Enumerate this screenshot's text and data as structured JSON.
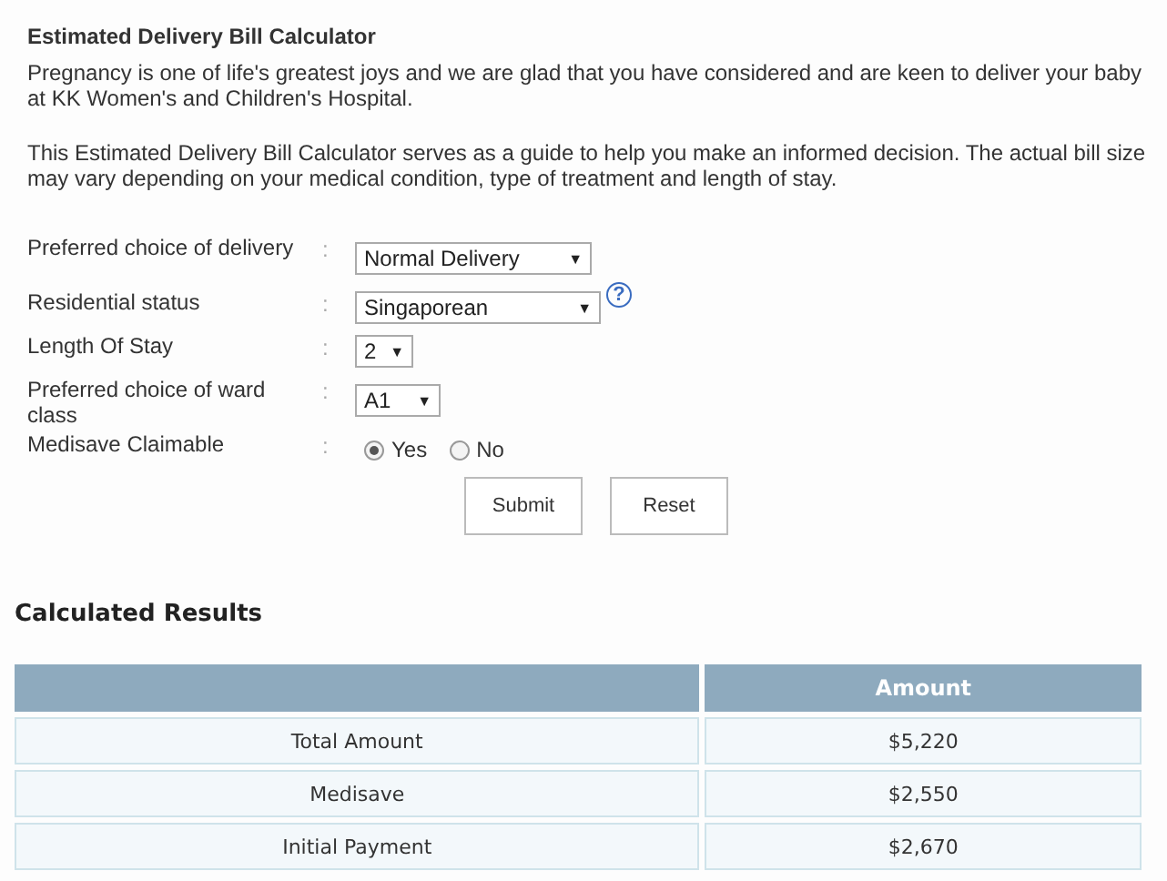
{
  "calculator": {
    "title": "Estimated Delivery Bill Calculator",
    "paragraphs": [
      "Pregnancy is one of life's greatest joys and we are glad that you have considered and are keen to deliver your baby at KK Women's and Children's Hospital.",
      "This Estimated Delivery Bill Calculator serves as a guide to help you make an informed decision. The actual bill size may vary depending on your medical condition, type of treatment and length of stay."
    ],
    "fields": [
      {
        "kind": "select",
        "label": "Preferred choice of delivery",
        "separator": ":",
        "value": "Normal Delivery",
        "arrow": "▼"
      },
      {
        "kind": "select",
        "label": "Residential status",
        "separator": ":",
        "value": "Singaporean",
        "arrow": "▼",
        "help": "?"
      },
      {
        "kind": "select",
        "label": "Length Of Stay",
        "separator": ":",
        "value": "2",
        "arrow": "▼"
      },
      {
        "kind": "select",
        "label": "Preferred choice of ward class",
        "separator": ":",
        "value": "A1",
        "arrow": "▼"
      },
      {
        "kind": "radio",
        "label": "Medisave Claimable",
        "separator": ":",
        "options": [
          {
            "label": "Yes",
            "selected": true
          },
          {
            "label": "No",
            "selected": false
          }
        ]
      }
    ],
    "buttons": [
      "Submit",
      "Reset"
    ]
  },
  "results": {
    "title": "Calculated Results",
    "table": {
      "columns": [
        "Amount"
      ],
      "rows": [
        {
          "item": "Total Amount",
          "amount": "$5,220"
        },
        {
          "item": "Medisave",
          "amount": "$2,550"
        },
        {
          "item": "Initial Payment",
          "amount": "$2,670"
        }
      ]
    }
  }
}
